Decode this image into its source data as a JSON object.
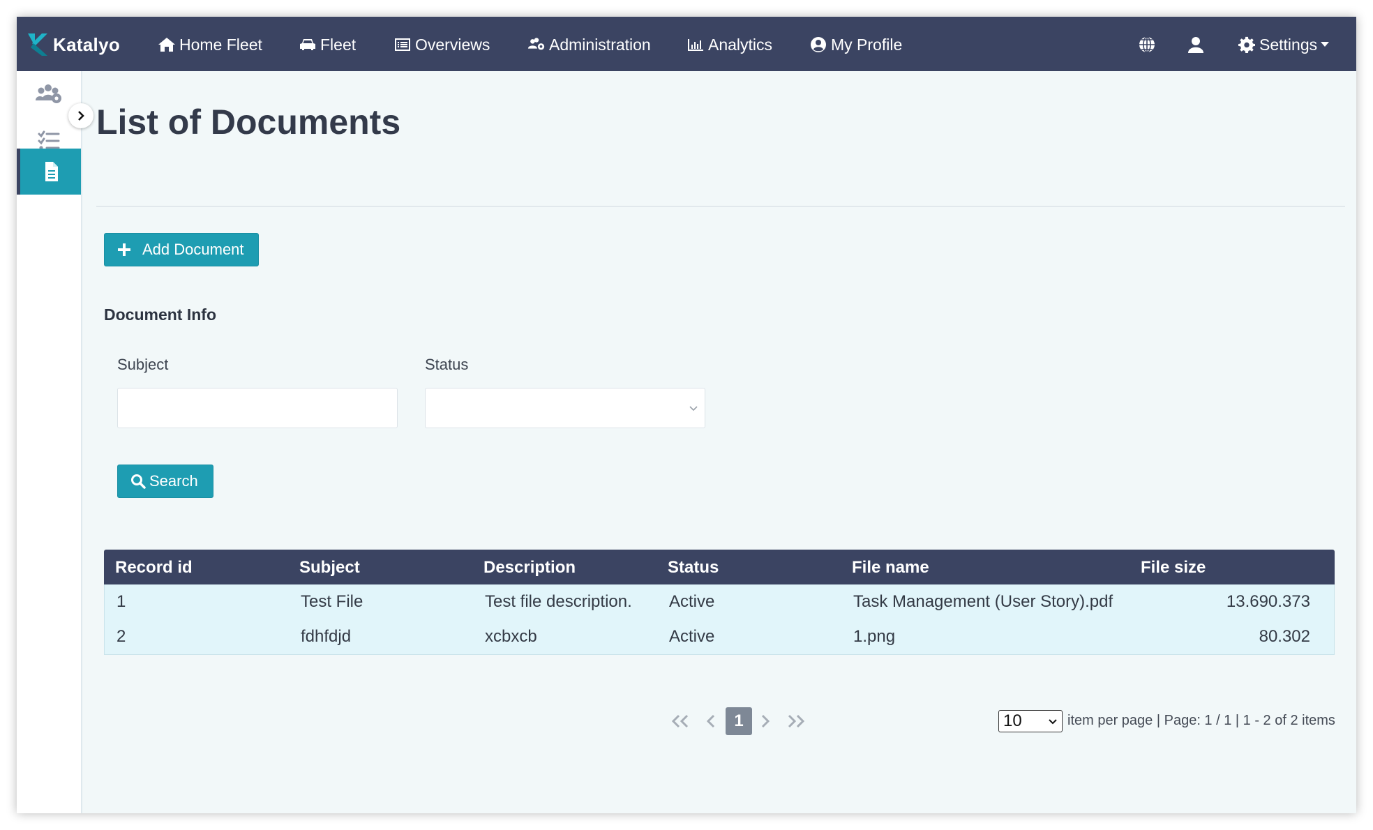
{
  "navbar": {
    "brand": "Katalyo",
    "items": [
      {
        "label": "Home Fleet",
        "icon": "home-icon"
      },
      {
        "label": "Fleet",
        "icon": "car-icon"
      },
      {
        "label": "Overviews",
        "icon": "list-alt-icon"
      },
      {
        "label": "Administration",
        "icon": "users-cog-icon"
      },
      {
        "label": "Analytics",
        "icon": "chart-bar-icon"
      },
      {
        "label": "My Profile",
        "icon": "user-circle-icon"
      }
    ],
    "right": {
      "language_icon": "globe-icon",
      "user_icon": "user-icon",
      "settings_label": "Settings",
      "settings_icon": "gear-icon"
    }
  },
  "sidebar": {
    "items": [
      {
        "icon": "users-cog-icon",
        "active": false
      },
      {
        "icon": "tasks-icon",
        "active": false
      },
      {
        "icon": "document-icon",
        "active": true
      }
    ],
    "toggle_icon": "chevron-right-icon"
  },
  "page": {
    "title": "List of Documents",
    "add_button": "Add Document",
    "section_title": "Document Info",
    "filters": {
      "subject_label": "Subject",
      "subject_value": "",
      "status_label": "Status",
      "status_value": ""
    },
    "search_button": "Search"
  },
  "table": {
    "columns": [
      "Record id",
      "Subject",
      "Description",
      "Status",
      "File name",
      "File size"
    ],
    "rows": [
      [
        "1",
        "Test File",
        "Test file description.",
        "Active",
        "Task Management (User Story).pdf",
        "13.690.373"
      ],
      [
        "2",
        "fdhfdjd",
        "xcbxcb",
        "Active",
        "1.png",
        "80.302"
      ]
    ]
  },
  "pagination": {
    "current_page": "1",
    "per_page": "10",
    "summary": "item per page | Page: 1 / 1 | 1 - 2 of 2 items"
  },
  "colors": {
    "navbar": "#3b4462",
    "accent": "#1e9db2",
    "background": "#f2f8f9",
    "row_background": "#e1f5fa"
  }
}
